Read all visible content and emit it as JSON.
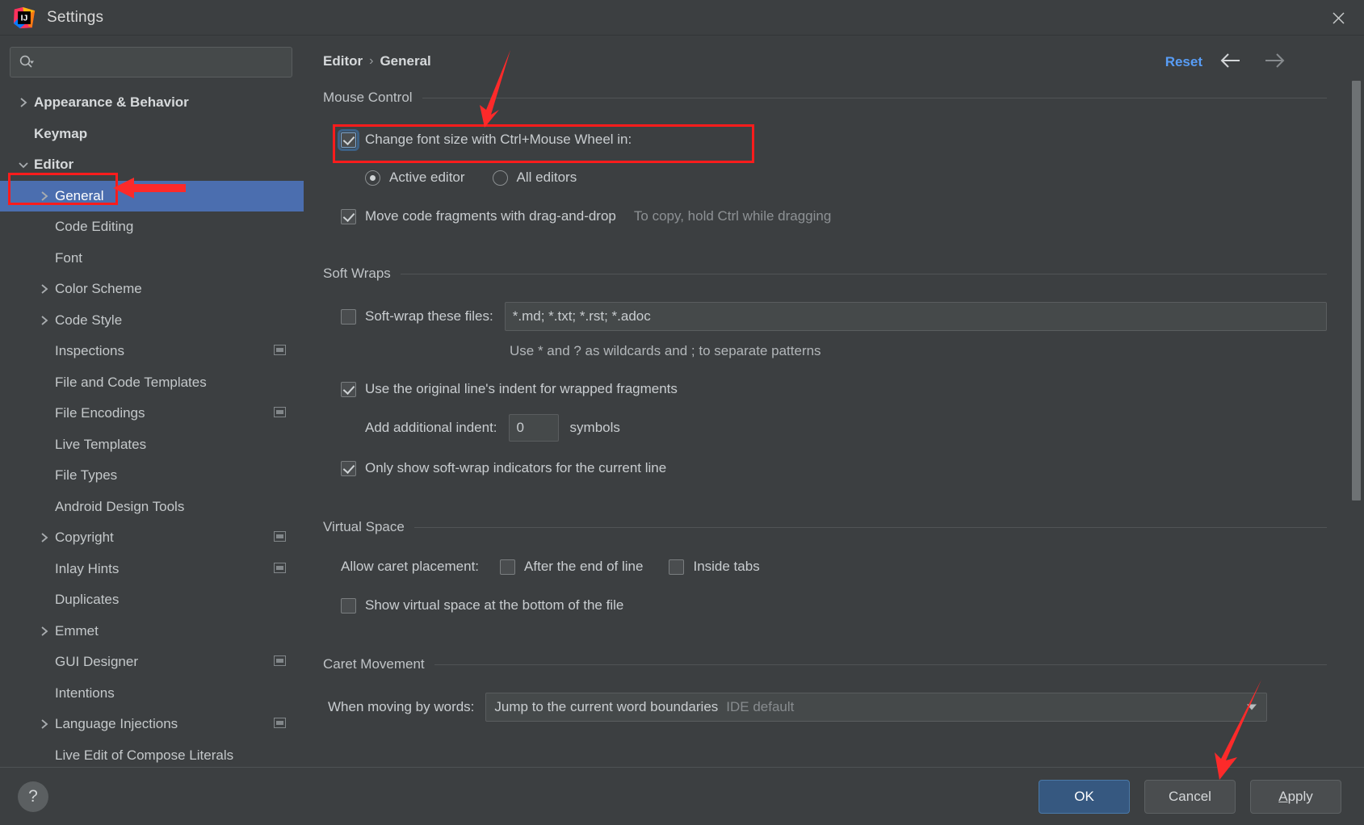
{
  "window": {
    "title": "Settings",
    "logo_icon": "intellij-idea-logo",
    "close_icon": "close-icon"
  },
  "search": {
    "placeholder": "",
    "value": "",
    "icon": "search-icon"
  },
  "sidebar": {
    "items": [
      {
        "label": "Appearance & Behavior",
        "arrow": "chevron-right",
        "level": 0,
        "bold": true,
        "selected": false,
        "config_icon": false
      },
      {
        "label": "Keymap",
        "arrow": "none",
        "level": 0,
        "bold": true,
        "selected": false,
        "config_icon": false
      },
      {
        "label": "Editor",
        "arrow": "chevron-down",
        "level": 0,
        "bold": true,
        "selected": false,
        "config_icon": false
      },
      {
        "label": "General",
        "arrow": "chevron-right",
        "level": 1,
        "bold": false,
        "selected": true,
        "config_icon": false
      },
      {
        "label": "Code Editing",
        "arrow": "none",
        "level": 1,
        "bold": false,
        "selected": false,
        "config_icon": false
      },
      {
        "label": "Font",
        "arrow": "none",
        "level": 1,
        "bold": false,
        "selected": false,
        "config_icon": false
      },
      {
        "label": "Color Scheme",
        "arrow": "chevron-right",
        "level": 1,
        "bold": false,
        "selected": false,
        "config_icon": false
      },
      {
        "label": "Code Style",
        "arrow": "chevron-right",
        "level": 1,
        "bold": false,
        "selected": false,
        "config_icon": false
      },
      {
        "label": "Inspections",
        "arrow": "none",
        "level": 1,
        "bold": false,
        "selected": false,
        "config_icon": true
      },
      {
        "label": "File and Code Templates",
        "arrow": "none",
        "level": 1,
        "bold": false,
        "selected": false,
        "config_icon": false
      },
      {
        "label": "File Encodings",
        "arrow": "none",
        "level": 1,
        "bold": false,
        "selected": false,
        "config_icon": true
      },
      {
        "label": "Live Templates",
        "arrow": "none",
        "level": 1,
        "bold": false,
        "selected": false,
        "config_icon": false
      },
      {
        "label": "File Types",
        "arrow": "none",
        "level": 1,
        "bold": false,
        "selected": false,
        "config_icon": false
      },
      {
        "label": "Android Design Tools",
        "arrow": "none",
        "level": 1,
        "bold": false,
        "selected": false,
        "config_icon": false
      },
      {
        "label": "Copyright",
        "arrow": "chevron-right",
        "level": 1,
        "bold": false,
        "selected": false,
        "config_icon": true
      },
      {
        "label": "Inlay Hints",
        "arrow": "none",
        "level": 1,
        "bold": false,
        "selected": false,
        "config_icon": true
      },
      {
        "label": "Duplicates",
        "arrow": "none",
        "level": 1,
        "bold": false,
        "selected": false,
        "config_icon": false
      },
      {
        "label": "Emmet",
        "arrow": "chevron-right",
        "level": 1,
        "bold": false,
        "selected": false,
        "config_icon": false
      },
      {
        "label": "GUI Designer",
        "arrow": "none",
        "level": 1,
        "bold": false,
        "selected": false,
        "config_icon": true
      },
      {
        "label": "Intentions",
        "arrow": "none",
        "level": 1,
        "bold": false,
        "selected": false,
        "config_icon": false
      },
      {
        "label": "Language Injections",
        "arrow": "chevron-right",
        "level": 1,
        "bold": false,
        "selected": false,
        "config_icon": true
      },
      {
        "label": "Live Edit of Compose Literals",
        "arrow": "none",
        "level": 1,
        "bold": false,
        "selected": false,
        "config_icon": false
      }
    ]
  },
  "header": {
    "breadcrumb_root": "Editor",
    "breadcrumb_sep": "›",
    "breadcrumb_leaf": "General",
    "reset_label": "Reset",
    "back_icon": "arrow-left-icon",
    "forward_icon": "arrow-right-icon"
  },
  "sections": {
    "mouse_control": {
      "title": "Mouse Control",
      "change_font_size_label": "Change font size with Ctrl+Mouse Wheel in:",
      "change_font_size_checked": true,
      "radio_active_editor": "Active editor",
      "radio_all_editors": "All editors",
      "radio_selected": "Active editor",
      "move_code_fragments_label": "Move code fragments with drag-and-drop",
      "move_code_fragments_checked": true,
      "move_code_fragments_hint": "To copy, hold Ctrl while dragging"
    },
    "soft_wraps": {
      "title": "Soft Wraps",
      "soft_wrap_files_label": "Soft-wrap these files:",
      "soft_wrap_files_checked": false,
      "soft_wrap_files_value": "*.md; *.txt; *.rst; *.adoc",
      "wildcards_hint": "Use * and ? as wildcards and ; to separate patterns",
      "original_indent_label": "Use the original line's indent for wrapped fragments",
      "original_indent_checked": true,
      "additional_indent_label": "Add additional indent:",
      "additional_indent_value": "0",
      "additional_indent_suffix": "symbols",
      "only_show_indicators_label": "Only show soft-wrap indicators for the current line",
      "only_show_indicators_checked": true
    },
    "virtual_space": {
      "title": "Virtual Space",
      "allow_caret_label": "Allow caret placement:",
      "after_end_of_line_label": "After the end of line",
      "after_end_of_line_checked": false,
      "inside_tabs_label": "Inside tabs",
      "inside_tabs_checked": false,
      "show_virtual_space_label": "Show virtual space at the bottom of the file",
      "show_virtual_space_checked": false
    },
    "caret_movement": {
      "title": "Caret Movement",
      "when_moving_label": "When moving by words:",
      "when_moving_value": "Jump to the current word boundaries",
      "when_moving_suffix": "IDE default",
      "dropdown_icon": "chevron-down-icon"
    }
  },
  "footer": {
    "help_label": "?",
    "ok_label": "OK",
    "cancel_label": "Cancel",
    "apply_label": "Apply",
    "apply_mnemonic": "A",
    "apply_rest": "pply"
  },
  "annotations": {
    "accent_color": "#fd1c1c",
    "arrow_to_checkbox": "red-arrow-pointing-to-change-font-size-checkbox",
    "arrow_to_general": "red-arrow-pointing-to-general-tree-item",
    "arrow_to_apply": "red-arrow-pointing-to-apply-button",
    "box_around_editor": "red-box-around-editor-tree-item",
    "box_around_checkbox": "red-box-around-change-font-size-row"
  }
}
